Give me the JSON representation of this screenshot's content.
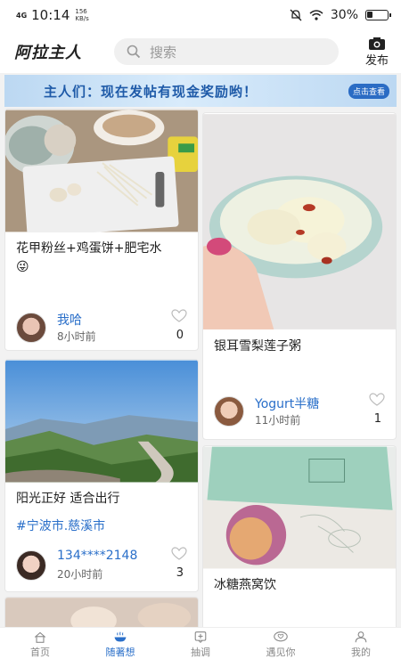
{
  "status_bar": {
    "network": "4G",
    "time": "10:14",
    "speed_value": "156",
    "speed_unit": "KB/s",
    "battery": "30%",
    "battery_level": 0.3
  },
  "header": {
    "logo": "阿拉主人",
    "search_placeholder": "搜索",
    "publish_label": "发布"
  },
  "banner": {
    "text": "主人们：现在发帖有现金奖励哟！",
    "button": "点击查看"
  },
  "colors": {
    "accent": "#2a6fc9",
    "banner_bg": "#c9e0f6",
    "banner_text": "#1e5aa8"
  },
  "feed": [
    {
      "title": "花甲粉丝+鸡蛋饼+肥宅水",
      "emoji": "😜",
      "user": "我哈",
      "time": "8小时前",
      "likes": "0"
    },
    {
      "title": "银耳雪梨莲子粥",
      "user": "Yogurt半糖",
      "time": "11小时前",
      "likes": "1"
    },
    {
      "title": "阳光正好 适合出行",
      "tag": "#宁波市.慈溪市",
      "user": "134****2148",
      "time": "20小时前",
      "likes": "3"
    },
    {
      "title": "冰糖燕窝饮"
    }
  ],
  "bottom_nav": [
    {
      "label": "首页",
      "icon": "home-icon"
    },
    {
      "label": "随著想",
      "icon": "bowl-icon"
    },
    {
      "label": "抽调",
      "icon": "add-post-icon"
    },
    {
      "label": "遇见你",
      "icon": "heart-chat-icon"
    },
    {
      "label": "我的",
      "icon": "person-icon"
    }
  ]
}
